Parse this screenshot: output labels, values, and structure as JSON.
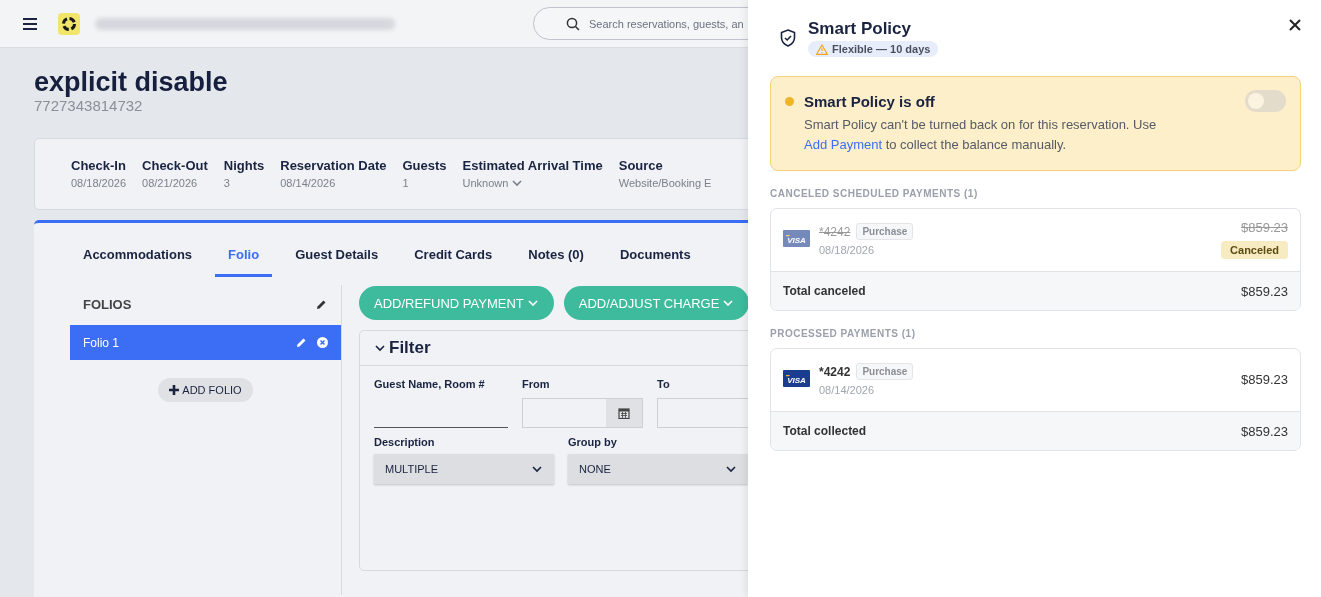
{
  "topbar": {
    "search": {
      "placeholder": "Search reservations, guests, an"
    }
  },
  "reservation": {
    "name": "explicit disable",
    "number": "7727343814732"
  },
  "details": [
    {
      "label": "Check-In",
      "value": "08/18/2026",
      "kind": "text"
    },
    {
      "label": "Check-Out",
      "value": "08/21/2026",
      "kind": "text"
    },
    {
      "label": "Nights",
      "value": "3",
      "kind": "text"
    },
    {
      "label": "Reservation Date",
      "value": "08/14/2026",
      "kind": "text"
    },
    {
      "label": "Guests",
      "value": "1",
      "kind": "text"
    },
    {
      "label": "Estimated Arrival Time",
      "value": "Unknown",
      "kind": "dropdown"
    },
    {
      "label": "Source",
      "value": "Website/Booking E",
      "kind": "text"
    }
  ],
  "tabs": [
    {
      "label": "Accommodations",
      "selected": false
    },
    {
      "label": "Folio",
      "selected": true
    },
    {
      "label": "Guest Details",
      "selected": false
    },
    {
      "label": "Credit Cards",
      "selected": false
    },
    {
      "label": "Notes (0)",
      "selected": false
    },
    {
      "label": "Documents",
      "selected": false
    }
  ],
  "folios": {
    "title": "FOLIOS",
    "items": [
      {
        "label": "Folio 1",
        "selected": true
      }
    ],
    "add_button": "ADD FOLIO"
  },
  "actions": [
    {
      "label": "ADD/REFUND PAYMENT"
    },
    {
      "label": "ADD/ADJUST CHARGE"
    }
  ],
  "filter": {
    "title": "Filter",
    "expanded": true,
    "rows": [
      [
        {
          "label": "Guest Name, Room #",
          "kind": "text"
        },
        {
          "label": "From",
          "kind": "date"
        },
        {
          "label": "To",
          "kind": "box"
        }
      ],
      [
        {
          "label": "Description",
          "kind": "select",
          "value": "MULTIPLE"
        },
        {
          "label": "Group by",
          "kind": "select",
          "value": "NONE"
        }
      ]
    ]
  },
  "smart_policy": {
    "title": "Smart Policy",
    "badge": "Flexible — 10 days",
    "alert": {
      "title": "Smart Policy is off",
      "on": false,
      "text": "Smart Policy can't be turned back on for this reservation. Use",
      "link": "Add Payment",
      "text_after": "to collect the balance manually."
    }
  },
  "payment_sections": [
    {
      "title": "CANCELED SCHEDULED PAYMENTS (1)",
      "payments": [
        {
          "brand": "VISA",
          "card": "*4242",
          "type": "Purchase",
          "date": "08/18/2026",
          "amount": "$859.23",
          "canceled": true,
          "status": "Canceled"
        }
      ],
      "total_label": "Total canceled",
      "total": "$859.23"
    },
    {
      "title": "PROCESSED PAYMENTS (1)",
      "payments": [
        {
          "brand": "VISA",
          "card": "*4242",
          "type": "Purchase",
          "date": "08/14/2026",
          "amount": "$859.23",
          "canceled": false
        }
      ],
      "total_label": "Total collected",
      "total": "$859.23"
    }
  ]
}
